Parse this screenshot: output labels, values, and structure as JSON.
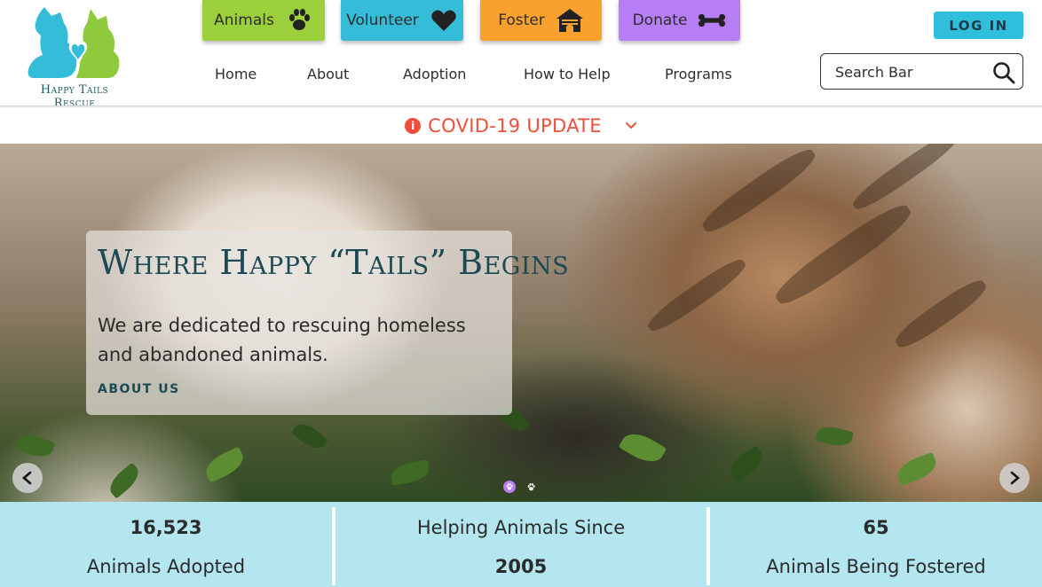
{
  "brand": {
    "name": "Happy Tails Rescue"
  },
  "action_buttons": [
    {
      "label": "Animals",
      "icon": "paw-icon",
      "color": "#9bd03c"
    },
    {
      "label": "Volunteer",
      "icon": "heart-icon",
      "color": "#35bcd8"
    },
    {
      "label": "Foster",
      "icon": "house-icon",
      "color": "#f8a12e"
    },
    {
      "label": "Donate",
      "icon": "bone-icon",
      "color": "#b87ef5"
    }
  ],
  "login": {
    "label": "LOG IN",
    "color": "#2fbfdc"
  },
  "nav": {
    "items": [
      {
        "label": "Home"
      },
      {
        "label": "About"
      },
      {
        "label": "Adoption"
      },
      {
        "label": "How to Help"
      },
      {
        "label": "Programs"
      }
    ]
  },
  "search": {
    "placeholder": "Search Bar",
    "value": "",
    "icon": "search-icon"
  },
  "covid_banner": {
    "text": "COVID-19 UPDATE",
    "icon": "info-icon",
    "expand_icon": "chevron-down-icon",
    "color": "#f24f3a"
  },
  "hero": {
    "title": "Where Happy “Tails” Begins",
    "subtitle": "We are dedicated to rescuing homeless and abandoned animals.",
    "link": "ABOUT US",
    "prev_icon": "chevron-left-icon",
    "next_icon": "chevron-right-icon",
    "active_slide": 1,
    "slide_count": 2
  },
  "stats": [
    {
      "top": "16,523",
      "bottom": "Animals Adopted"
    },
    {
      "top": "Helping Animals Since",
      "bottom": "2005"
    },
    {
      "top": "65",
      "bottom": "Animals Being Fostered"
    }
  ],
  "colors": {
    "stats_bg": "#b3e6ef",
    "title": "#1b4a55",
    "accent_purple": "#b87ef5"
  }
}
